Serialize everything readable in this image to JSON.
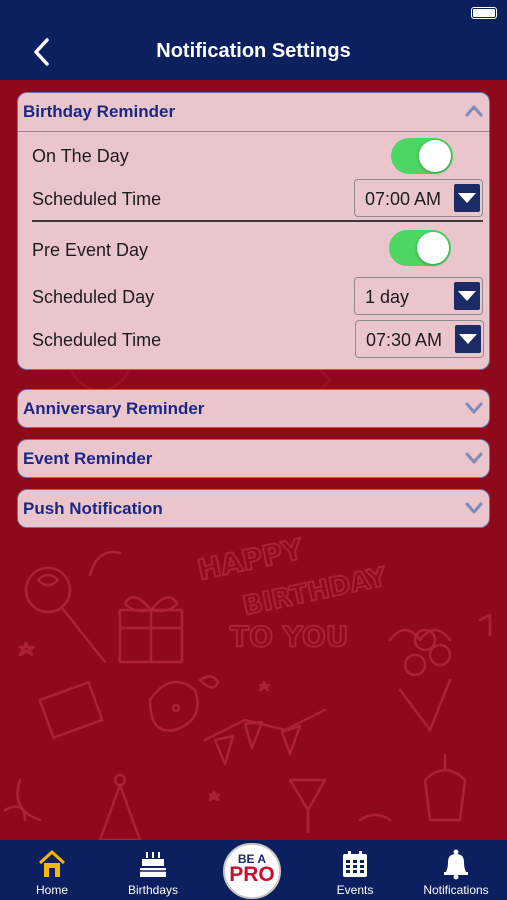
{
  "header": {
    "title": "Notification Settings",
    "back_icon": "chevron-left-icon"
  },
  "colors": {
    "nav": "#0c2060",
    "background": "#8e0a1a",
    "panel": "#ebc5cc",
    "accent": "#1b2883",
    "toggle_on": "#4cd663"
  },
  "birthday": {
    "title": "Birthday Reminder",
    "on_the_day": {
      "label": "On The Day",
      "enabled": true
    },
    "scheduled_time_1": {
      "label": "Scheduled Time",
      "value": "07:00 AM"
    },
    "pre_event_day": {
      "label": "Pre Event Day",
      "enabled": true
    },
    "scheduled_day": {
      "label": "Scheduled Day",
      "value": "1 day"
    },
    "scheduled_time_2": {
      "label": "Scheduled Time",
      "value": "07:30 AM"
    }
  },
  "anniversary": {
    "title": "Anniversary Reminder"
  },
  "event": {
    "title": "Event Reminder"
  },
  "push": {
    "title": "Push Notification"
  },
  "tabs": {
    "home": "Home",
    "birthdays": "Birthdays",
    "pro_top": "BE A",
    "pro_main": "PRO",
    "events": "Events",
    "notifications": "Notifications"
  }
}
